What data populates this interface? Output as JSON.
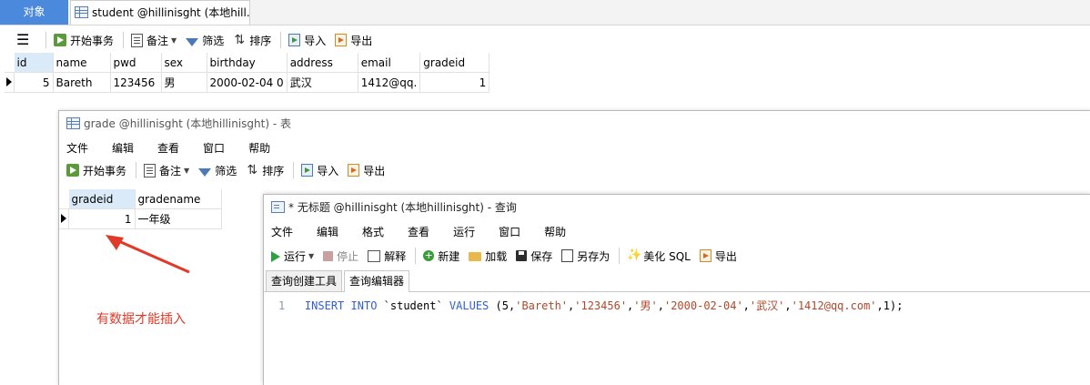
{
  "tabs": {
    "objects": "对象",
    "student_tab": "student @hillinisght (本地hill..."
  },
  "student_toolbar": {
    "begin_transaction": "开始事务",
    "note": "备注",
    "filter": "筛选",
    "sort": "排序",
    "import": "导入",
    "export": "导出"
  },
  "student_table": {
    "columns": [
      "id",
      "name",
      "pwd",
      "sex",
      "birthday",
      "address",
      "email",
      "gradeid"
    ],
    "rows": [
      [
        "5",
        "Bareth",
        "123456",
        "男",
        "2000-02-04 0",
        "武汉",
        "1412@qq.",
        "1"
      ]
    ]
  },
  "grade_window": {
    "title": "grade @hillinisght (本地hillinisght) - 表",
    "menu": [
      "文件",
      "编辑",
      "查看",
      "窗口",
      "帮助"
    ],
    "toolbar": {
      "begin_transaction": "开始事务",
      "note": "备注",
      "filter": "筛选",
      "sort": "排序",
      "import": "导入",
      "export": "导出"
    },
    "columns": [
      "gradeid",
      "gradename"
    ],
    "rows": [
      [
        "1",
        "一年级"
      ]
    ]
  },
  "annotation": {
    "text": "有数据才能插入",
    "color": "#e03a2a"
  },
  "query_window": {
    "title": "* 无标题 @hillinisght (本地hillinisght) - 查询",
    "menu": [
      "文件",
      "编辑",
      "格式",
      "查看",
      "运行",
      "窗口",
      "帮助"
    ],
    "toolbar": {
      "run": "运行",
      "stop": "停止",
      "explain": "解释",
      "new": "新建",
      "load": "加载",
      "save": "保存",
      "save_as": "另存为",
      "beautify": "美化 SQL",
      "export": "导出"
    },
    "tabs": [
      "查询创建工具",
      "查询编辑器"
    ],
    "active_tab": "查询编辑器",
    "editor": {
      "line_number": "1",
      "kw_insert": "INSERT",
      "kw_into": "INTO",
      "table": "`student`",
      "kw_values": "VALUES",
      "open": "(",
      "v1": "5",
      "v2": "'Bareth'",
      "v3": "'123456'",
      "v4": "'男'",
      "v5": "'2000-02-04'",
      "v6": "'武汉'",
      "v7": "'1412@qq.com'",
      "v8": "1",
      "close": ");",
      "comma": ","
    }
  },
  "colors": {
    "accent": "#4a89dc",
    "keyword": "#2f5fd0",
    "string": "#b0482a",
    "run": "#2ea043"
  }
}
